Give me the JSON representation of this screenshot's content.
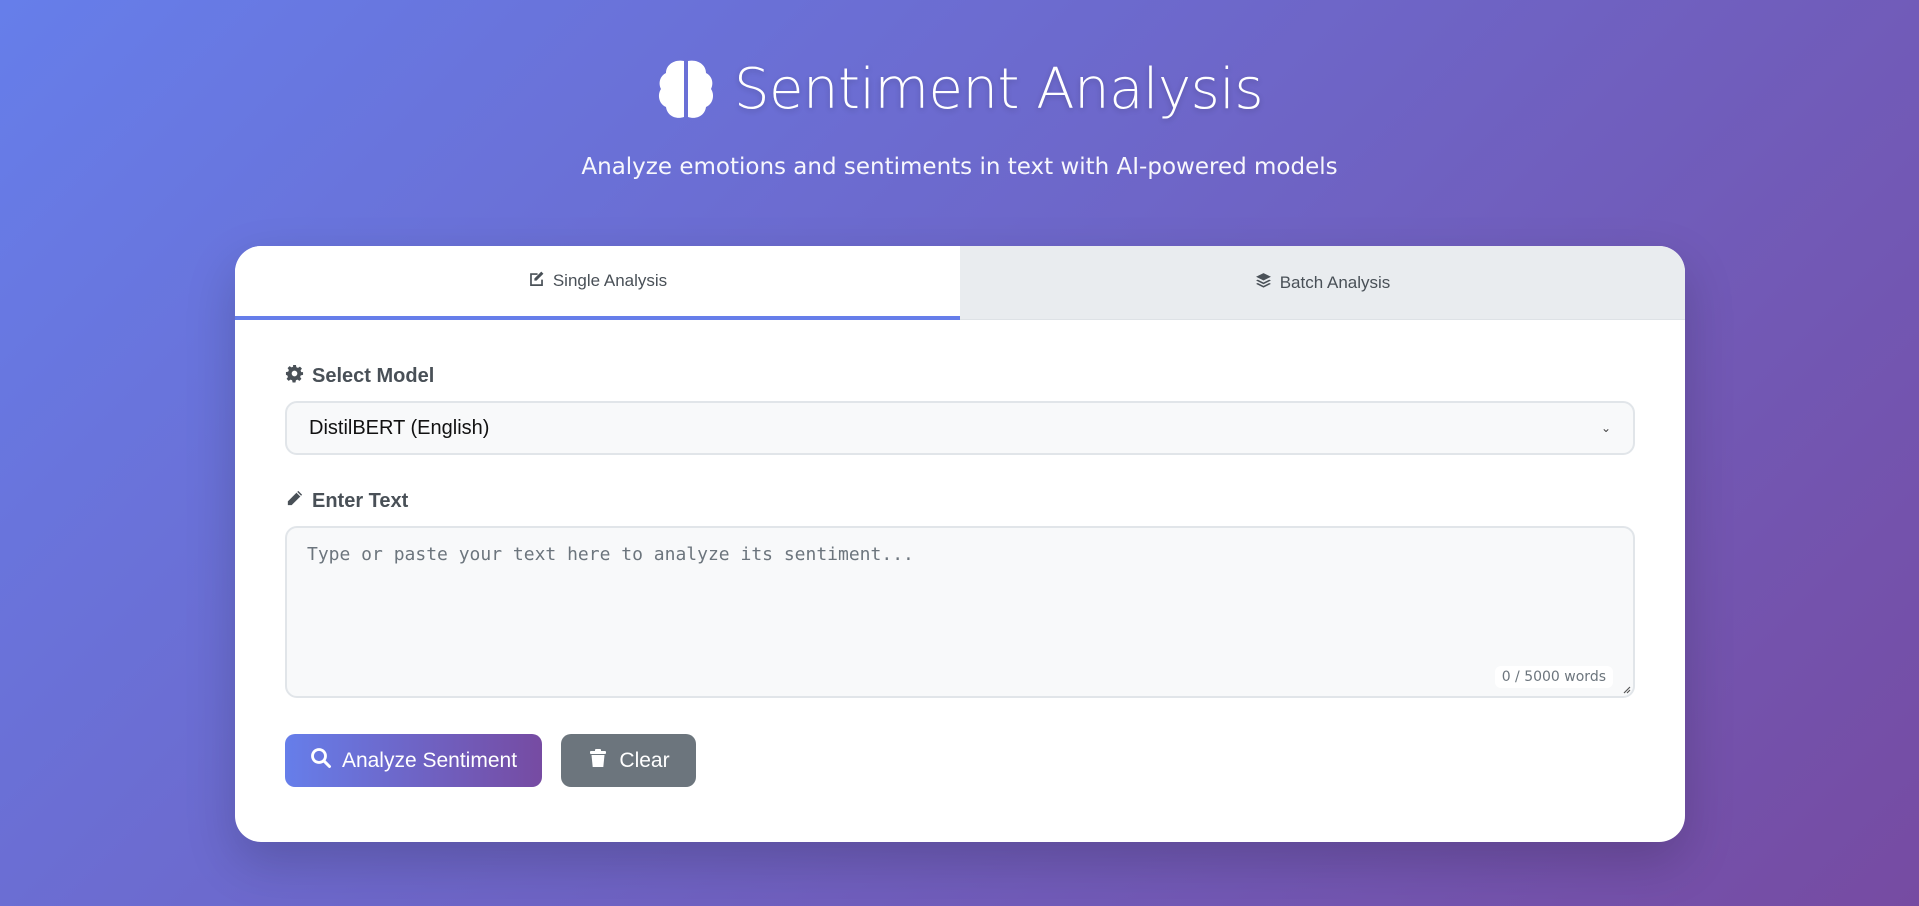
{
  "header": {
    "title": "Sentiment Analysis",
    "subtitle": "Analyze emotions and sentiments in text with AI-powered models",
    "icon": "brain-icon"
  },
  "tabs": [
    {
      "label": "Single Analysis",
      "icon": "edit-icon",
      "active": true
    },
    {
      "label": "Batch Analysis",
      "icon": "layers-icon",
      "active": false
    }
  ],
  "model": {
    "label": "Select Model",
    "icon": "gear-icon",
    "selected": "DistilBERT (English)"
  },
  "text_input": {
    "label": "Enter Text",
    "icon": "pencil-icon",
    "value": "",
    "placeholder": "Type or paste your text here to analyze its sentiment...",
    "counter": "0 / 5000 words"
  },
  "actions": {
    "analyze_label": "Analyze Sentiment",
    "clear_label": "Clear"
  },
  "colors": {
    "gradient_start": "#667eea",
    "gradient_end": "#764ba2",
    "secondary_button": "#6c757d",
    "tab_inactive": "#e9ecef"
  }
}
